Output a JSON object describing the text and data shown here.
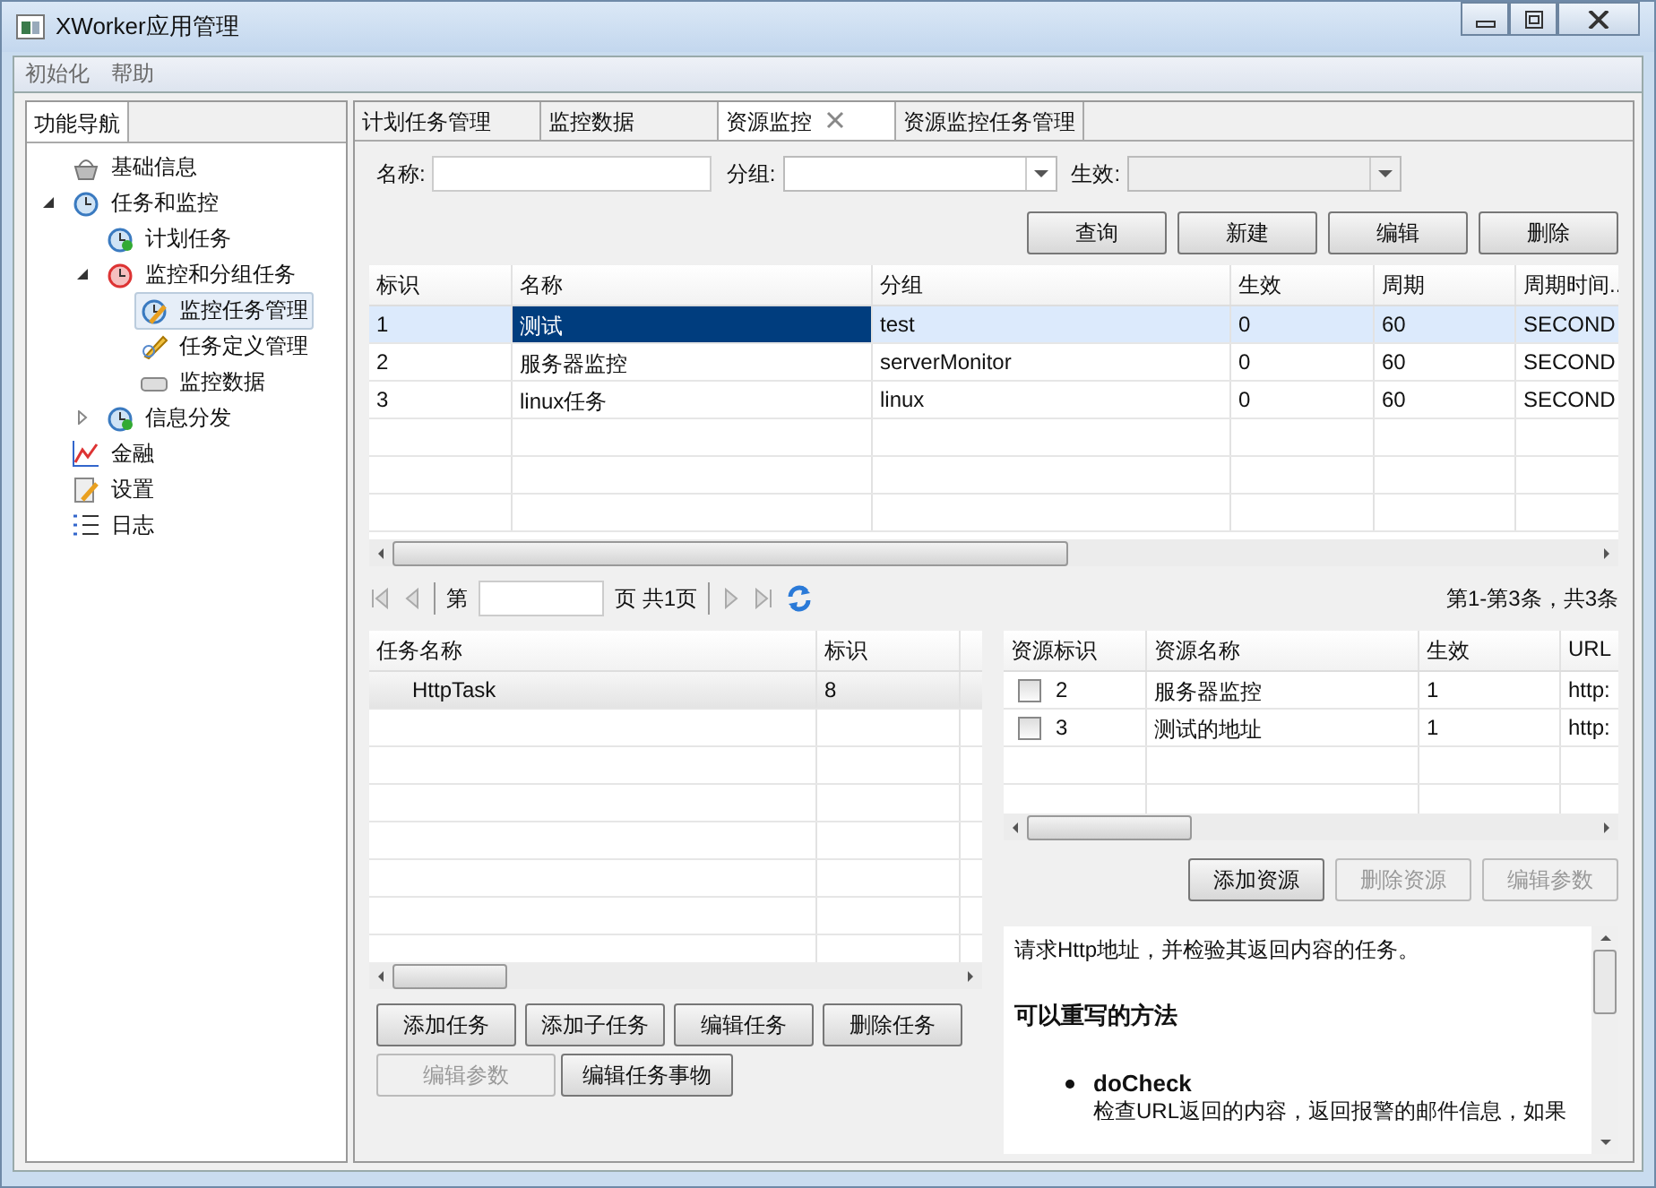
{
  "window": {
    "title": "XWorker应用管理"
  },
  "menu": [
    "初始化",
    "帮助"
  ],
  "nav": {
    "tab": "功能导航",
    "items": [
      {
        "label": "基础信息",
        "kind": "basket",
        "selected": false
      },
      {
        "label": "任务和监控",
        "kind": "clock",
        "selected": false,
        "expanded": true,
        "children": [
          {
            "label": "计划任务",
            "kind": "clockgo",
            "selected": false
          },
          {
            "label": "监控和分组任务",
            "kind": "alarm",
            "selected": false,
            "expanded": true,
            "children": [
              {
                "label": "监控任务管理",
                "kind": "clockedit",
                "selected": true
              },
              {
                "label": "任务定义管理",
                "kind": "pencil",
                "selected": false
              },
              {
                "label": "监控数据",
                "kind": "drive",
                "selected": false
              }
            ]
          },
          {
            "label": "信息分发",
            "kind": "clockgo",
            "selected": false,
            "expanded": false
          }
        ]
      },
      {
        "label": "金融",
        "kind": "chart",
        "selected": false
      },
      {
        "label": "设置",
        "kind": "note",
        "selected": false
      },
      {
        "label": "日志",
        "kind": "list",
        "selected": false
      }
    ]
  },
  "tabs": [
    {
      "label": "计划任务管理",
      "selected": false,
      "closable": false
    },
    {
      "label": "监控数据",
      "selected": false,
      "closable": false
    },
    {
      "label": "资源监控",
      "selected": true,
      "closable": true
    },
    {
      "label": "资源监控任务管理",
      "selected": false,
      "closable": false
    }
  ],
  "filters": {
    "name_label": "名称:",
    "group_label": "分组:",
    "active_label": "生效:"
  },
  "actions": [
    {
      "label": "查询",
      "disabled": false
    },
    {
      "label": "新建",
      "disabled": false
    },
    {
      "label": "编辑",
      "disabled": false
    },
    {
      "label": "删除",
      "disabled": false
    }
  ],
  "task_table": {
    "columns": [
      "标识",
      "名称",
      "分组",
      "生效",
      "周期",
      "周期时间.."
    ],
    "rows": [
      {
        "cells": [
          "1",
          "测试",
          "test",
          "0",
          "60",
          "SECOND"
        ],
        "selected": true
      },
      {
        "cells": [
          "2",
          "服务器监控",
          "serverMonitor",
          "0",
          "60",
          "SECOND"
        ],
        "selected": false
      },
      {
        "cells": [
          "3",
          "linux任务",
          "linux",
          "0",
          "60",
          "SECOND"
        ],
        "selected": false
      }
    ]
  },
  "pager": {
    "prefix": "第",
    "suffix": "页 共1页",
    "summary": "第1-第3条，共3条"
  },
  "subtask_table": {
    "columns": [
      "任务名称",
      "标识"
    ],
    "rows": [
      {
        "cells": [
          "HttpTask",
          "8"
        ],
        "selected": true
      }
    ]
  },
  "subtask_buttons": [
    {
      "label": "添加任务",
      "disabled": false
    },
    {
      "label": "添加子任务",
      "disabled": false
    },
    {
      "label": "编辑任务",
      "disabled": false
    },
    {
      "label": "删除任务",
      "disabled": false
    },
    {
      "label": "编辑参数",
      "disabled": true
    },
    {
      "label": "编辑任务事物",
      "disabled": false
    }
  ],
  "resource_table": {
    "columns": [
      "资源标识",
      "资源名称",
      "生效",
      "URL"
    ],
    "rows": [
      {
        "checked": false,
        "cells": [
          "2",
          "服务器监控",
          "1",
          "http:"
        ]
      },
      {
        "checked": false,
        "cells": [
          "3",
          "测试的地址",
          "1",
          "http:"
        ]
      }
    ]
  },
  "resource_buttons": [
    {
      "label": "添加资源",
      "disabled": false
    },
    {
      "label": "删除资源",
      "disabled": true
    },
    {
      "label": "编辑参数",
      "disabled": true
    }
  ],
  "description": {
    "intro": "请求Http地址，并检验其返回内容的任务。",
    "heading": "可以重写的方法",
    "methods": [
      {
        "name": "doCheck",
        "text": "检查URL返回的内容，返回报警的邮件信息，如果"
      }
    ]
  }
}
